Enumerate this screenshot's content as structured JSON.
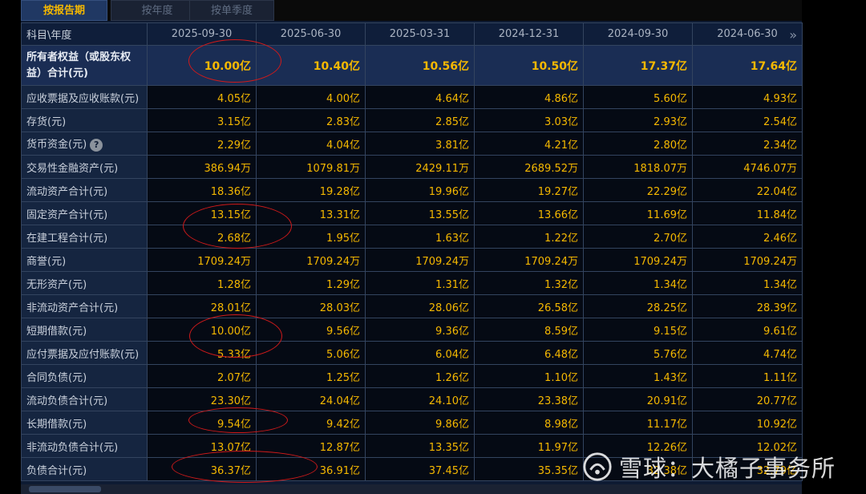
{
  "tabs": [
    {
      "label": "按报告期",
      "active": true
    },
    {
      "label": "按年度",
      "active": false
    },
    {
      "label": "按单季度",
      "active": false
    }
  ],
  "table": {
    "corner_label": "科目\\年度",
    "columns": [
      "2025-09-30",
      "2025-06-30",
      "2025-03-31",
      "2024-12-31",
      "2024-09-30",
      "2024-06-30"
    ],
    "rows": [
      {
        "label": "所有者权益（或股东权益）合计(元)",
        "values": [
          "10.00亿",
          "10.40亿",
          "10.56亿",
          "10.50亿",
          "17.37亿",
          "17.64亿"
        ]
      },
      {
        "label": "应收票据及应收账款(元)",
        "values": [
          "4.05亿",
          "4.00亿",
          "4.64亿",
          "4.86亿",
          "5.60亿",
          "4.93亿"
        ]
      },
      {
        "label": "存货(元)",
        "values": [
          "3.15亿",
          "2.83亿",
          "2.85亿",
          "3.03亿",
          "2.93亿",
          "2.54亿"
        ]
      },
      {
        "label": "货币资金(元)",
        "values": [
          "2.29亿",
          "4.04亿",
          "3.81亿",
          "4.21亿",
          "2.80亿",
          "2.34亿"
        ]
      },
      {
        "label": "交易性金融资产(元)",
        "values": [
          "386.94万",
          "1079.81万",
          "2429.11万",
          "2689.52万",
          "1818.07万",
          "4746.07万"
        ]
      },
      {
        "label": "流动资产合计(元)",
        "values": [
          "18.36亿",
          "19.28亿",
          "19.96亿",
          "19.27亿",
          "22.29亿",
          "22.04亿"
        ]
      },
      {
        "label": "固定资产合计(元)",
        "values": [
          "13.15亿",
          "13.31亿",
          "13.55亿",
          "13.66亿",
          "11.69亿",
          "11.84亿"
        ]
      },
      {
        "label": "在建工程合计(元)",
        "values": [
          "2.68亿",
          "1.95亿",
          "1.63亿",
          "1.22亿",
          "2.70亿",
          "2.46亿"
        ]
      },
      {
        "label": "商誉(元)",
        "values": [
          "1709.24万",
          "1709.24万",
          "1709.24万",
          "1709.24万",
          "1709.24万",
          "1709.24万"
        ]
      },
      {
        "label": "无形资产(元)",
        "values": [
          "1.28亿",
          "1.29亿",
          "1.31亿",
          "1.32亿",
          "1.34亿",
          "1.34亿"
        ]
      },
      {
        "label": "非流动资产合计(元)",
        "values": [
          "28.01亿",
          "28.03亿",
          "28.06亿",
          "26.58亿",
          "28.25亿",
          "28.39亿"
        ]
      },
      {
        "label": "短期借款(元)",
        "values": [
          "10.00亿",
          "9.56亿",
          "9.36亿",
          "8.59亿",
          "9.15亿",
          "9.61亿"
        ]
      },
      {
        "label": "应付票据及应付账款(元)",
        "values": [
          "5.33亿",
          "5.06亿",
          "6.04亿",
          "6.48亿",
          "5.76亿",
          "4.74亿"
        ]
      },
      {
        "label": "合同负债(元)",
        "values": [
          "2.07亿",
          "1.25亿",
          "1.26亿",
          "1.10亿",
          "1.43亿",
          "1.11亿"
        ]
      },
      {
        "label": "流动负债合计(元)",
        "values": [
          "23.30亿",
          "24.04亿",
          "24.10亿",
          "23.38亿",
          "20.91亿",
          "20.77亿"
        ]
      },
      {
        "label": "长期借款(元)",
        "values": [
          "9.54亿",
          "9.42亿",
          "9.86亿",
          "8.98亿",
          "11.17亿",
          "10.92亿"
        ]
      },
      {
        "label": "非流动负债合计(元)",
        "values": [
          "13.07亿",
          "12.87亿",
          "13.35亿",
          "11.97亿",
          "12.26亿",
          "12.02亿"
        ]
      },
      {
        "label": "负债合计(元)",
        "values": [
          "36.37亿",
          "36.91亿",
          "37.45亿",
          "35.35亿",
          "32.38亿",
          "32.79亿"
        ]
      }
    ]
  },
  "help_icon_glyph": "?",
  "next_icon_glyph": "»",
  "watermark": "雪球：大橘子事务所",
  "colors": {
    "value": "#f5b800",
    "annotation": "#d01a1a",
    "header_bg": "#0f1e3a"
  },
  "icons": {
    "help": "question-circle-icon",
    "next": "double-chevron-right-icon",
    "logo": "snowball-logo-icon"
  }
}
